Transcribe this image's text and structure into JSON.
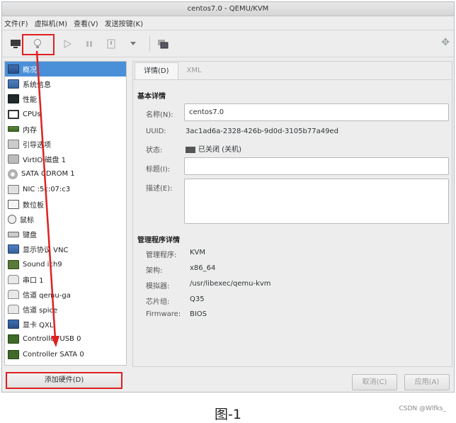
{
  "window": {
    "title": "centos7.0 - QEMU/KVM"
  },
  "menubar": [
    "文件(F)",
    "虚拟机(M)",
    "查看(V)",
    "发送按键(K)"
  ],
  "sidebar": {
    "items": [
      {
        "label": "概况",
        "icon": "overview-icon",
        "selected": true
      },
      {
        "label": "系统信息",
        "icon": "system-info-icon"
      },
      {
        "label": "性能",
        "icon": "performance-icon"
      },
      {
        "label": "CPUs",
        "icon": "cpu-icon"
      },
      {
        "label": "内存",
        "icon": "memory-icon"
      },
      {
        "label": "引导选项",
        "icon": "boot-options-icon"
      },
      {
        "label": "VirtIO 磁盘 1",
        "icon": "disk-icon"
      },
      {
        "label": "SATA CDROM 1",
        "icon": "cdrom-icon"
      },
      {
        "label": "NIC :5c:07:c3",
        "icon": "nic-icon"
      },
      {
        "label": "数位板",
        "icon": "tablet-icon"
      },
      {
        "label": "鼠标",
        "icon": "mouse-icon"
      },
      {
        "label": "键盘",
        "icon": "keyboard-icon"
      },
      {
        "label": "显示协议 VNC",
        "icon": "display-icon"
      },
      {
        "label": "Sound ich9",
        "icon": "sound-icon"
      },
      {
        "label": "串口 1",
        "icon": "serial-icon"
      },
      {
        "label": "信道 qemu-ga",
        "icon": "channel-icon"
      },
      {
        "label": "信道 spice",
        "icon": "channel-icon"
      },
      {
        "label": "显卡 QXL",
        "icon": "video-icon"
      },
      {
        "label": "Controller USB 0",
        "icon": "controller-icon"
      },
      {
        "label": "Controller SATA 0",
        "icon": "controller-icon"
      }
    ],
    "add_hardware": "添加硬件(D)"
  },
  "tabs": [
    "详情(D)",
    "XML"
  ],
  "basic": {
    "title": "基本详情",
    "name_label": "名称(N):",
    "name_value": "centos7.0",
    "uuid_label": "UUID:",
    "uuid_value": "3ac1ad6a-2328-426b-9d0d-3105b77a49ed",
    "state_label": "状态:",
    "state_value": "已关闭 (关机)",
    "title_label": "标题(I):",
    "title_value": "",
    "desc_label": "描述(E):",
    "desc_value": ""
  },
  "hypervisor": {
    "title": "管理程序详情",
    "rows": [
      {
        "label": "管理程序:",
        "value": "KVM"
      },
      {
        "label": "架构:",
        "value": "x86_64"
      },
      {
        "label": "模拟器:",
        "value": "/usr/libexec/qemu-kvm"
      },
      {
        "label": "芯片组:",
        "value": "Q35"
      },
      {
        "label": "Firmware:",
        "value": "BIOS"
      }
    ]
  },
  "buttons": {
    "cancel": "取消(C)",
    "apply": "应用(A)"
  },
  "caption": "图-1",
  "watermark": "CSDN @Wlfks_",
  "colors": {
    "highlight": "#e02020",
    "selection": "#4a90d9"
  }
}
